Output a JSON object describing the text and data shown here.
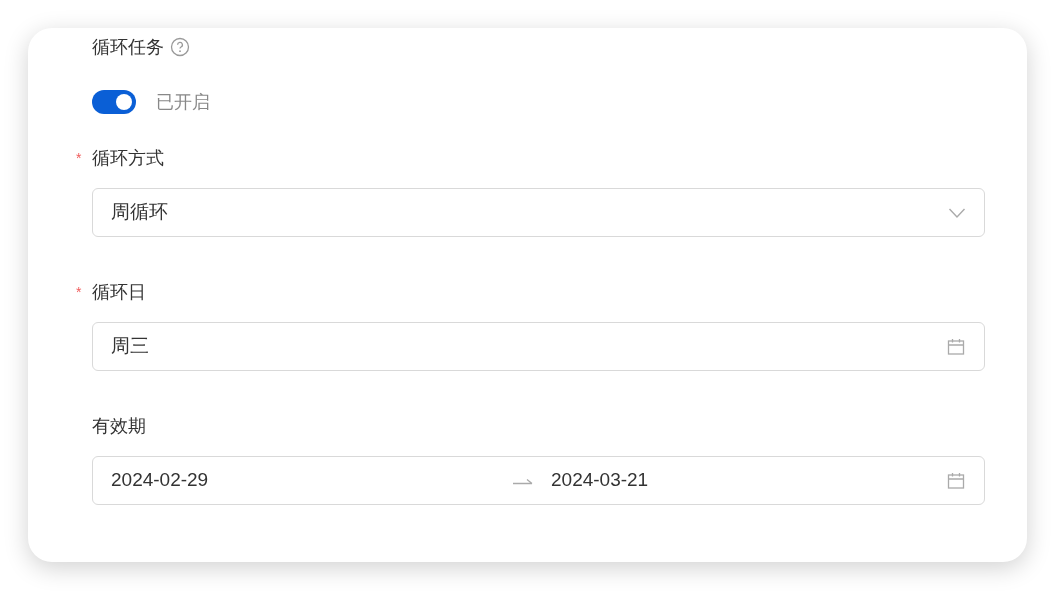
{
  "recurring_task": {
    "label": "循环任务",
    "enabled": true,
    "status_text": "已开启"
  },
  "fields": [
    {
      "kind": "select",
      "label": "循环方式",
      "required_mark": "*",
      "value": "周循环"
    },
    {
      "kind": "date",
      "label": "循环日",
      "required_mark": "*",
      "value": "周三"
    },
    {
      "kind": "range",
      "label": "有效期",
      "start": "2024-02-29",
      "end": "2024-03-21"
    }
  ]
}
